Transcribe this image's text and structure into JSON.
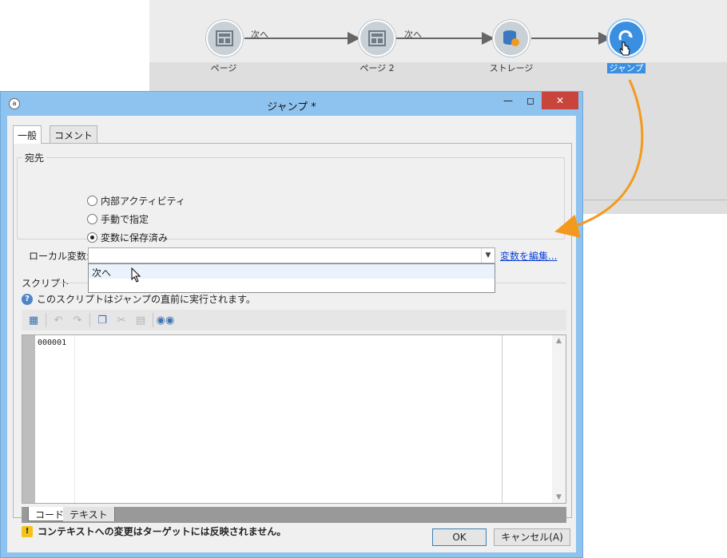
{
  "workflow": {
    "nodes": [
      {
        "label": "ページ",
        "icon": "page-icon"
      },
      {
        "label": "ページ 2",
        "icon": "page-icon"
      },
      {
        "label": "ストレージ",
        "icon": "storage-icon"
      },
      {
        "label": "ジャンプ",
        "icon": "jump-icon"
      }
    ],
    "edges": [
      "次へ",
      "次へ"
    ]
  },
  "dialog": {
    "title": "ジャンプ *",
    "tabs": [
      "一般",
      "コメント"
    ],
    "destination": {
      "legend": "宛先",
      "options": [
        "内部アクティビティ",
        "手動で指定",
        "変数に保存済み"
      ],
      "selected_index": 2
    },
    "local_var": {
      "label": "ローカル変数:",
      "value": "",
      "dropdown_option": "次へ",
      "edit_link": "変数を編集..."
    },
    "script": {
      "label": "スクリプト",
      "info": "このスクリプトはジャンプの直前に実行されます。",
      "line_number": "000001",
      "bottom_tabs": [
        "コード",
        "テキスト"
      ]
    },
    "warning": "コンテキストへの変更はターゲットには反映されません。",
    "buttons": {
      "ok": "OK",
      "cancel": "キャンセル(A)"
    }
  },
  "colors": {
    "accent": "#3b8fe0",
    "arrow": "#f39a1e",
    "titlebar": "#8fc3ef",
    "close": "#c9443a"
  }
}
